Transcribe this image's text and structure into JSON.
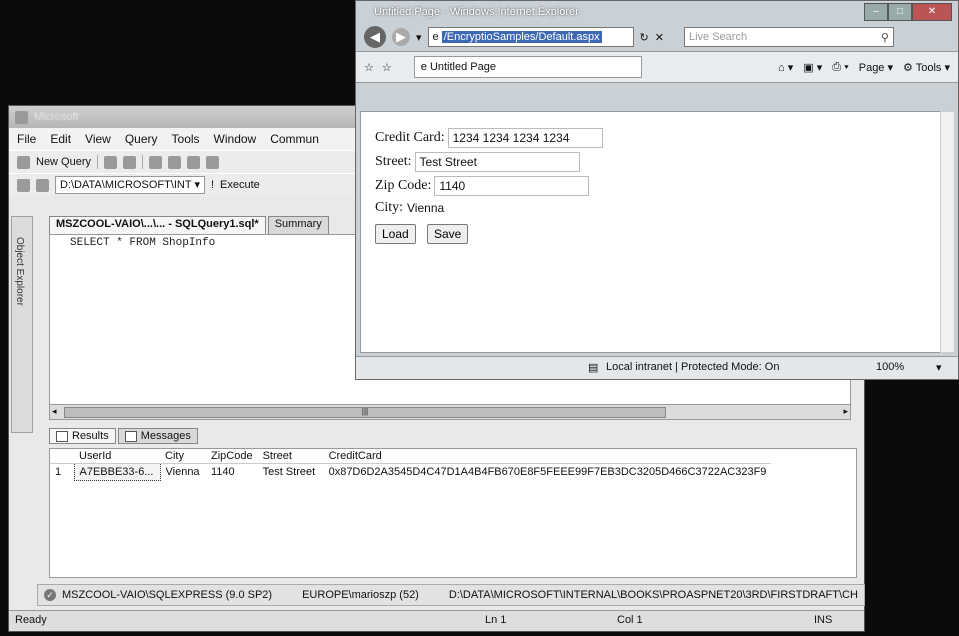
{
  "ssms": {
    "title_prefix": "Microsoft",
    "menu": [
      "File",
      "Edit",
      "View",
      "Query",
      "Tools",
      "Window",
      "Commun"
    ],
    "toolbar1": {
      "new_query": "New Query"
    },
    "toolbar2": {
      "path": "D:\\DATA\\MICROSOFT\\INT",
      "execute": "Execute"
    },
    "object_explorer": "Object Explorer",
    "doc_tab": "MSZCOOL-VAIO\\...\\... - SQLQuery1.sql*",
    "summary_tab": "Summary",
    "query": "SELECT * FROM ShopInfo",
    "result_tabs": [
      "Results",
      "Messages"
    ],
    "columns": [
      "UserId",
      "City",
      "ZipCode",
      "Street",
      "CreditCard"
    ],
    "rows": [
      {
        "num": "1",
        "UserId": "A7EBBE33-6...",
        "City": "Vienna",
        "ZipCode": "1140",
        "Street": "Test Street",
        "CreditCard": "0x87D6D2A3545D4C47D1A4B4FB670E8F5FEEE99F7EB3DC3205D466C3722AC323F9"
      }
    ],
    "conn_status": {
      "server": "MSZCOOL-VAIO\\SQLEXPRESS (9.0 SP2)",
      "user": "EUROPE\\marioszp (52)",
      "path": "D:\\DATA\\MICROSOFT\\INTERNAL\\BOOKS\\PROASPNET20\\3RD\\FIRSTDRAFT\\CH"
    },
    "status": {
      "ready": "Ready",
      "ln": "Ln 1",
      "col": "Col 1",
      "ins": "INS"
    }
  },
  "ie": {
    "title": "Untitled Page - Windows Internet Explorer",
    "url": "/EncryptioSamples/Default.aspx",
    "search_placeholder": "Live Search",
    "tab_title": "Untitled Page",
    "page_menu": "Page",
    "tools_menu": "Tools",
    "form": {
      "credit_label": "Credit Card:",
      "credit_value": "1234 1234 1234 1234",
      "street_label": "Street:",
      "street_value": "Test Street",
      "zip_label": "Zip Code:",
      "zip_value": "1140",
      "city_label": "City:",
      "city_value": "Vienna",
      "load": "Load",
      "save": "Save"
    },
    "status_zone": "Local intranet | Protected Mode: On",
    "zoom": "100%"
  }
}
